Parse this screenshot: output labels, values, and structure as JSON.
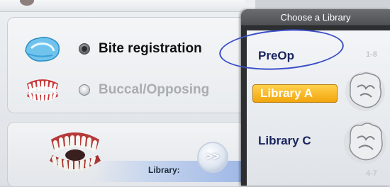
{
  "options": {
    "bite_label": "Bite registration",
    "buccal_label": "Buccal/Opposing"
  },
  "library_panel": {
    "label": "Library:",
    "next_button": ">>"
  },
  "chooser": {
    "title": "Choose a Library",
    "items": [
      {
        "label": "PreOp",
        "selected": false
      },
      {
        "label": "Library A",
        "selected": true
      },
      {
        "label": "Library C",
        "selected": false
      }
    ],
    "side_numbers": [
      "1-8",
      "4-7"
    ]
  },
  "colors": {
    "selected_item": "#f2a50c",
    "item_text": "#1a2560",
    "annotation_ring": "#3c4fc9",
    "inactive_text": "#a9adb2"
  },
  "icons": {
    "bite": "bite-registration-icon",
    "buccal": "buccal-opposing-icon",
    "jaw": "jaw-model-icon",
    "tooth_a": "molar-tooth-icon",
    "tooth_c": "molar-tooth-icon"
  }
}
